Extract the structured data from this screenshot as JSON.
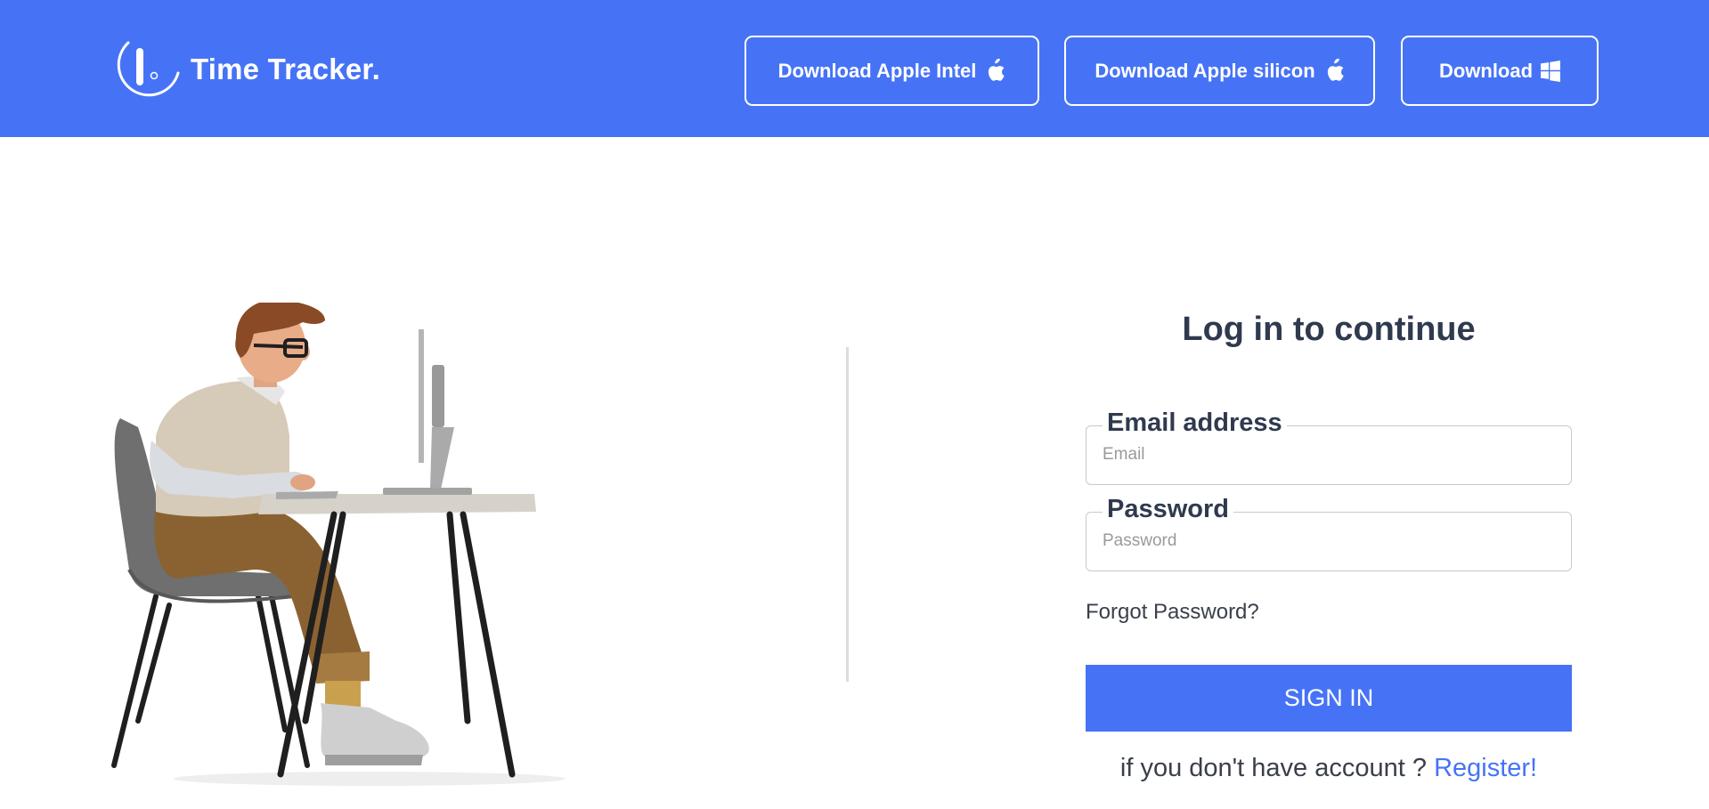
{
  "header": {
    "brand_name": "Time Tracker.",
    "buttons": [
      {
        "label": "Download Apple Intel",
        "icon": "apple-icon"
      },
      {
        "label": "Download Apple silicon",
        "icon": "apple-icon"
      },
      {
        "label": "Download",
        "icon": "windows-icon"
      }
    ]
  },
  "login": {
    "title": "Log in to continue",
    "email": {
      "label": "Email address",
      "placeholder": "Email",
      "value": ""
    },
    "password": {
      "label": "Password",
      "placeholder": "Password",
      "value": ""
    },
    "forgot_label": "Forgot Password?",
    "submit_label": "SIGN IN",
    "register_prompt": "if you don't have account ?",
    "register_link": "Register!"
  },
  "colors": {
    "accent": "#4673f6",
    "text": "#2f3a4f",
    "border": "#c9c9cf",
    "divider": "#dcdcdc"
  }
}
